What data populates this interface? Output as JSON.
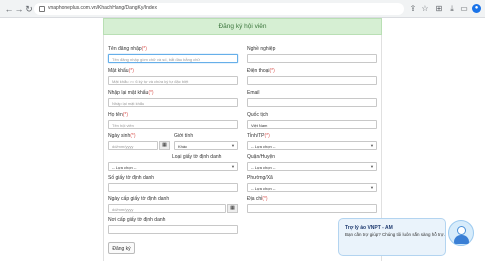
{
  "browser": {
    "url": "vnaphoneplus.com.vn/KhachHang/DangKy/Index",
    "icons": [
      "back-icon",
      "forward-icon",
      "reload-icon",
      "share-icon",
      "bookmark-star-icon",
      "extensions-icon",
      "download-icon",
      "profile-icon"
    ]
  },
  "header": {
    "title": "Đăng ký hội viên"
  },
  "form": {
    "username": {
      "label": "Tên đăng nhập",
      "required": "(*)",
      "placeholder": "Tên đăng nhập gồm chữ và số, bắt đầu bằng chữ"
    },
    "job": {
      "label": "Nghề nghiệp",
      "value": ""
    },
    "password": {
      "label": "Mật khẩu",
      "required": "(*)",
      "placeholder": "Mật khẩu >= 6 ký tự và chứa ký tự đặc biệt"
    },
    "phone": {
      "label": "Điện thoại",
      "required": "(*)",
      "value": ""
    },
    "repassword": {
      "label": "Nhập lại mật khẩu",
      "required": "(*)",
      "placeholder": "Nhập lại mật khẩu"
    },
    "email": {
      "label": "Email",
      "value": ""
    },
    "fullname": {
      "label": "Họ tên",
      "required": "(*)",
      "placeholder": "Tên hội viên"
    },
    "country": {
      "label": "Quốc tịch",
      "value": "Việt Nam"
    },
    "birthday": {
      "label": "Ngày sinh",
      "required": "(*)",
      "placeholder": "dd/mm/yyyy",
      "calendar_icon": "calendar-icon"
    },
    "gender": {
      "label": "Giới tính",
      "selected": "Khác"
    },
    "province": {
      "label": "Tỉnh/TP",
      "required": "(*)",
      "selected": "-- Lựa chọn --"
    },
    "id_type": {
      "label": "Loại giấy tờ định danh",
      "selected": "-- Lựa chọn --"
    },
    "district": {
      "label": "Quận/Huyện",
      "selected": "-- Lựa chọn --"
    },
    "id_number": {
      "label": "Số giấy tờ định danh",
      "value": ""
    },
    "ward": {
      "label": "Phường/Xã",
      "selected": "-- Lựa chọn --"
    },
    "id_date": {
      "label": "Ngày cấp giấy tờ định danh",
      "placeholder": "dd/mm/yyyy"
    },
    "address": {
      "label": "Địa chỉ",
      "required": "(*)",
      "value": ""
    },
    "id_place": {
      "label": "Nơi cấp giấy tờ định danh",
      "value": ""
    },
    "submit_label": "Đăng ký"
  },
  "chat": {
    "title": "Trợ lý ảo VNPT - AM",
    "message": "Bạn cần trợ giúp? Chúng tôi luôn sẵn sàng hỗ trợ."
  }
}
